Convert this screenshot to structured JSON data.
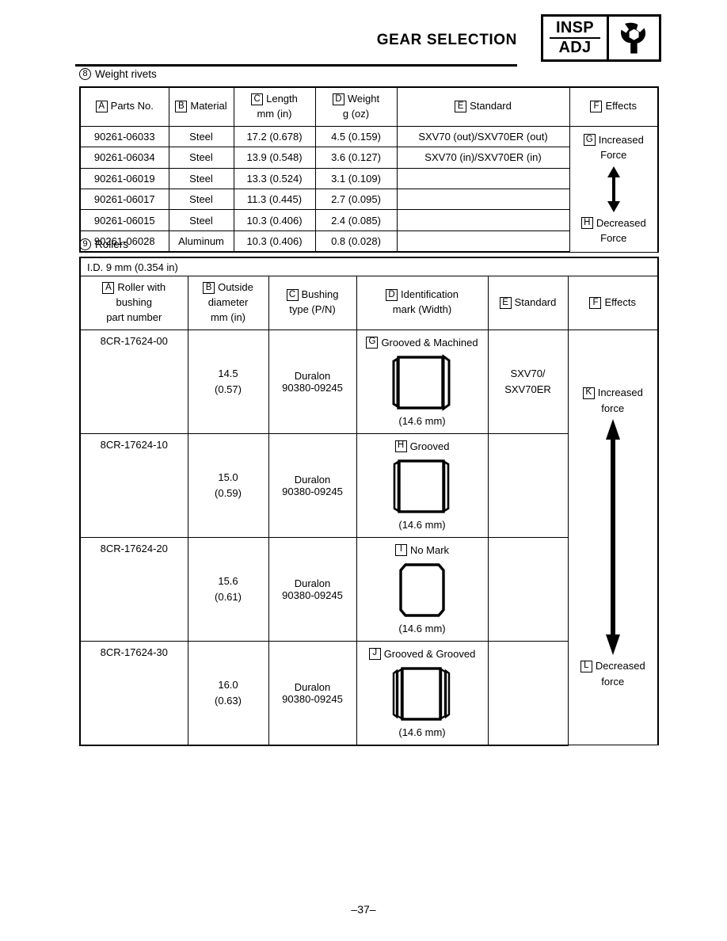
{
  "header": {
    "title": "GEAR SELECTION",
    "insp_label": "INSP",
    "adj_label": "ADJ",
    "icon": "wrench-nut-icon"
  },
  "sections": {
    "weight_rivets": {
      "number": "8",
      "title": "Weight rivets",
      "columns": [
        {
          "key": "A",
          "label_line1": "Parts No.",
          "label_line2": ""
        },
        {
          "key": "B",
          "label_line1": "Material",
          "label_line2": ""
        },
        {
          "key": "C",
          "label_line1": "Length",
          "label_line2": "mm (in)"
        },
        {
          "key": "D",
          "label_line1": "Weight",
          "label_line2": "g (oz)"
        },
        {
          "key": "E",
          "label_line1": "Standard",
          "label_line2": ""
        },
        {
          "key": "F",
          "label_line1": "Effects",
          "label_line2": ""
        }
      ],
      "rows": [
        {
          "parts_no": "90261-06033",
          "material": "Steel",
          "length": "17.2 (0.678)",
          "weight": "4.5 (0.159)",
          "standard": "SXV70 (out)/SXV70ER (out)"
        },
        {
          "parts_no": "90261-06034",
          "material": "Steel",
          "length": "13.9 (0.548)",
          "weight": "3.6 (0.127)",
          "standard": "SXV70 (in)/SXV70ER (in)"
        },
        {
          "parts_no": "90261-06019",
          "material": "Steel",
          "length": "13.3 (0.524)",
          "weight": "3.1 (0.109)",
          "standard": ""
        },
        {
          "parts_no": "90261-06017",
          "material": "Steel",
          "length": "11.3 (0.445)",
          "weight": "2.7 (0.095)",
          "standard": ""
        },
        {
          "parts_no": "90261-06015",
          "material": "Steel",
          "length": "10.3 (0.406)",
          "weight": "2.4 (0.085)",
          "standard": ""
        },
        {
          "parts_no": "90261-06028",
          "material": "Aluminum",
          "length": "10.3 (0.406)",
          "weight": "0.8 (0.028)",
          "standard": ""
        }
      ],
      "effects": {
        "top_key": "G",
        "top_line1": "Increased",
        "top_line2": "Force",
        "bottom_key": "H",
        "bottom_line1": "Decreased",
        "bottom_line2": "Force",
        "arrow": "double-headed-vertical-arrow"
      }
    },
    "rollers": {
      "number": "9",
      "title": "Rollers",
      "spec_note": "I.D. 9 mm (0.354 in)",
      "columns": [
        {
          "key": "A",
          "label_line1": "Roller with",
          "label_line2": "bushing",
          "label_line3": "part number"
        },
        {
          "key": "B",
          "label_line1": "Outside",
          "label_line2": "diameter",
          "label_line3": "mm (in)"
        },
        {
          "key": "C",
          "label_line1": "Bushing",
          "label_line2": "type (P/N)",
          "label_line3": ""
        },
        {
          "key": "D",
          "label_line1": "Identification",
          "label_line2": "mark (Width)",
          "label_line3": ""
        },
        {
          "key": "E",
          "label_line1": "Standard",
          "label_line2": "",
          "label_line3": ""
        },
        {
          "key": "F",
          "label_line1": "Effects",
          "label_line2": "",
          "label_line3": ""
        }
      ],
      "rows": [
        {
          "part_number": "8CR-17624-00",
          "od_mm": "14.5",
          "od_in": "(0.57)",
          "bushing_type": "Duralon",
          "bushing_pn": "90380-09245",
          "mark_key": "G",
          "mark_label": "Grooved & Machined",
          "mark_shape": "roller-grooved-machined",
          "width": "(14.6 mm)",
          "standard_line1": "SXV70/",
          "standard_line2": "SXV70ER"
        },
        {
          "part_number": "8CR-17624-10",
          "od_mm": "15.0",
          "od_in": "(0.59)",
          "bushing_type": "Duralon",
          "bushing_pn": "90380-09245",
          "mark_key": "H",
          "mark_label": "Grooved",
          "mark_shape": "roller-grooved",
          "width": "(14.6 mm)",
          "standard_line1": "",
          "standard_line2": ""
        },
        {
          "part_number": "8CR-17624-20",
          "od_mm": "15.6",
          "od_in": "(0.61)",
          "bushing_type": "Duralon",
          "bushing_pn": "90380-09245",
          "mark_key": "I",
          "mark_label": "No Mark",
          "mark_shape": "roller-no-mark",
          "width": "(14.6 mm)",
          "standard_line1": "",
          "standard_line2": ""
        },
        {
          "part_number": "8CR-17624-30",
          "od_mm": "16.0",
          "od_in": "(0.63)",
          "bushing_type": "Duralon",
          "bushing_pn": "90380-09245",
          "mark_key": "J",
          "mark_label": "Grooved & Grooved",
          "mark_shape": "roller-grooved-grooved",
          "width": "(14.6 mm)",
          "standard_line1": "",
          "standard_line2": ""
        }
      ],
      "effects": {
        "top_key": "K",
        "top_line1": "Increased",
        "top_line2": "force",
        "bottom_key": "L",
        "bottom_line1": "Decreased",
        "bottom_line2": "force",
        "arrow": "double-headed-vertical-arrow"
      }
    }
  },
  "footer": {
    "page_number": "–37–"
  }
}
